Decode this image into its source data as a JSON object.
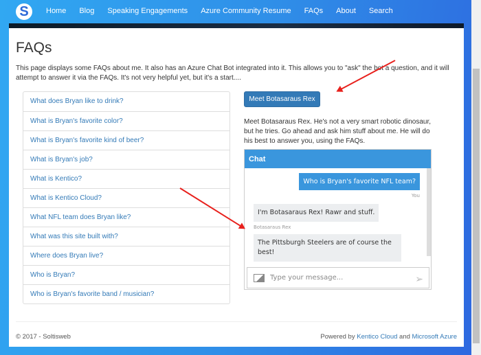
{
  "nav": {
    "logo": "S",
    "items": [
      "Home",
      "Blog",
      "Speaking Engagements",
      "Azure Community Resume",
      "FAQs",
      "About",
      "Search"
    ]
  },
  "page": {
    "title": "FAQs",
    "intro": "This page displays some FAQs about me. It also has an Azure Chat Bot integrated into it. This allows you to \"ask\" the bot a question, and it will attempt to answer it via the FAQs. It's not very helpful yet, but it's a start...."
  },
  "faqs": [
    "What does Bryan like to drink?",
    "What is Bryan's favorite color?",
    "What is Bryan's favorite kind of beer?",
    "What is Bryan's job?",
    "What is Kentico?",
    "What is Kentico Cloud?",
    "What NFL team does Bryan like?",
    "What was this site built with?",
    "Where does Bryan live?",
    "Who is Bryan?",
    "Who is Bryan's favorite band / musician?"
  ],
  "bot": {
    "button": "Meet Botasaraus Rex",
    "description": "Meet Botasaraus Rex. He's not a very smart robotic dinosaur, but he tries. Go ahead and ask him stuff about me. He will do his best to answer you, using the FAQs."
  },
  "chat": {
    "title": "Chat",
    "user_message": "Who is Bryan's favorite NFL team?",
    "user_label": "You",
    "bot_message_1": "I'm Botasaraus Rex! Rawr and stuff.",
    "bot_label": "Botasaraus Rex",
    "bot_message_2": "The Pittsburgh Steelers are of course the best!",
    "placeholder": "Type your message..."
  },
  "footer": {
    "copyright": "© 2017 - Soltisweb",
    "powered_by": "Powered by",
    "link1": "Kentico Cloud",
    "and": "and",
    "link2": "Microsoft Azure"
  },
  "colors": {
    "accent": "#337ab7",
    "chat_header": "#3a96dd",
    "annotation_arrow": "#e8201c"
  }
}
